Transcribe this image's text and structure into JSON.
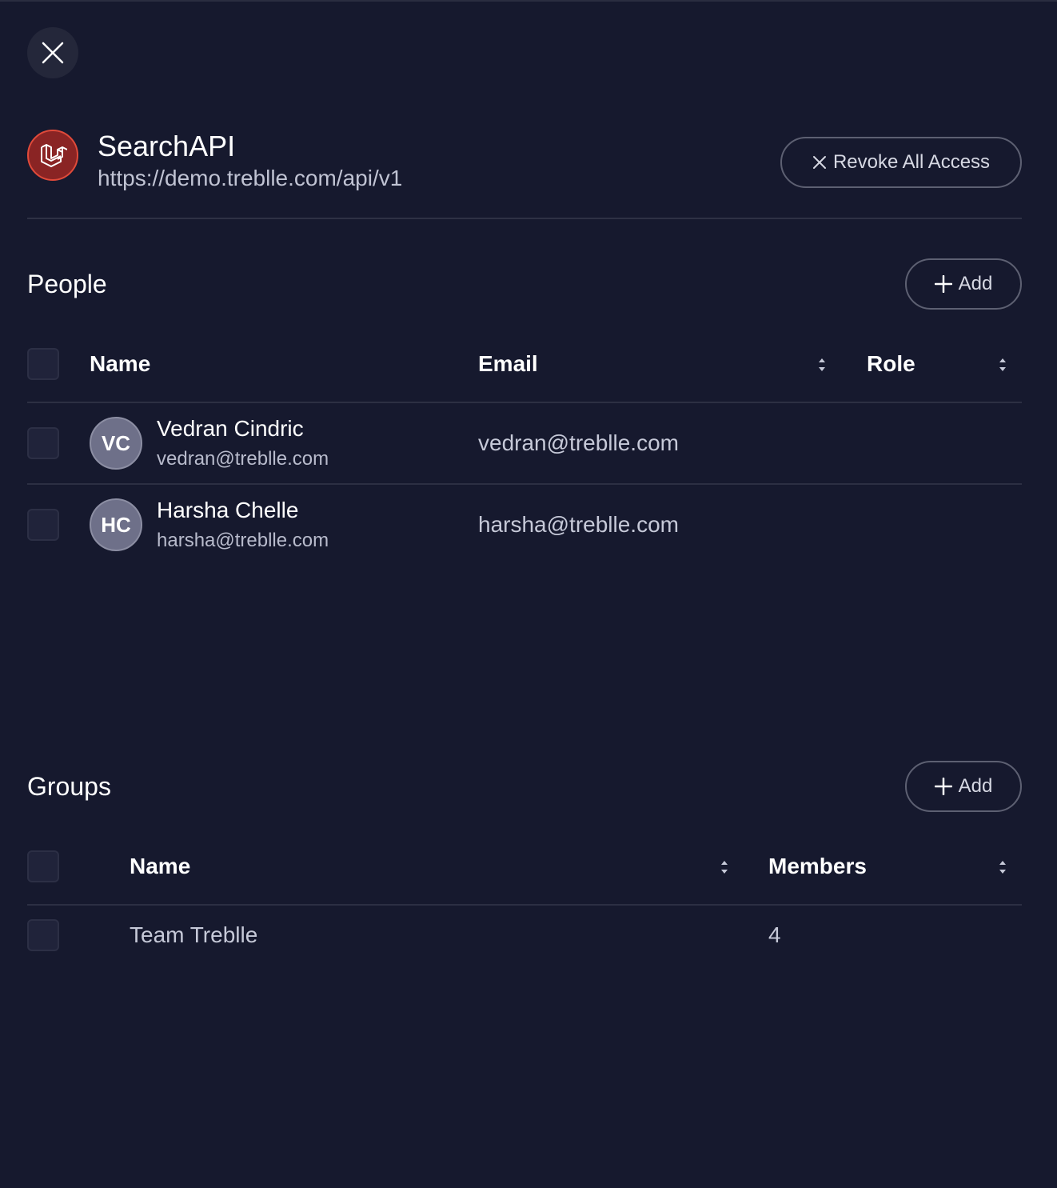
{
  "api": {
    "name": "SearchAPI",
    "url": "https://demo.treblle.com/api/v1",
    "revoke_label": "Revoke All Access"
  },
  "people": {
    "title": "People",
    "add_label": "Add",
    "columns": {
      "name": "Name",
      "email": "Email",
      "role": "Role"
    },
    "rows": [
      {
        "initials": "VC",
        "name": "Vedran Cindric",
        "sub_email": "vedran@treblle.com",
        "email": "vedran@treblle.com",
        "role": ""
      },
      {
        "initials": "HC",
        "name": "Harsha Chelle",
        "sub_email": "harsha@treblle.com",
        "email": "harsha@treblle.com",
        "role": ""
      }
    ]
  },
  "groups": {
    "title": "Groups",
    "add_label": "Add",
    "columns": {
      "name": "Name",
      "members": "Members"
    },
    "rows": [
      {
        "name": "Team Treblle",
        "members": "4"
      }
    ]
  },
  "colors": {
    "background": "#16192e",
    "accent_logo": "#e04a3a",
    "avatar": "#6e7089"
  },
  "icons": {
    "close": "close-icon",
    "logo": "laravel-logo-icon",
    "revoke": "x-icon",
    "add": "plus-icon",
    "sort": "sort-icon"
  }
}
